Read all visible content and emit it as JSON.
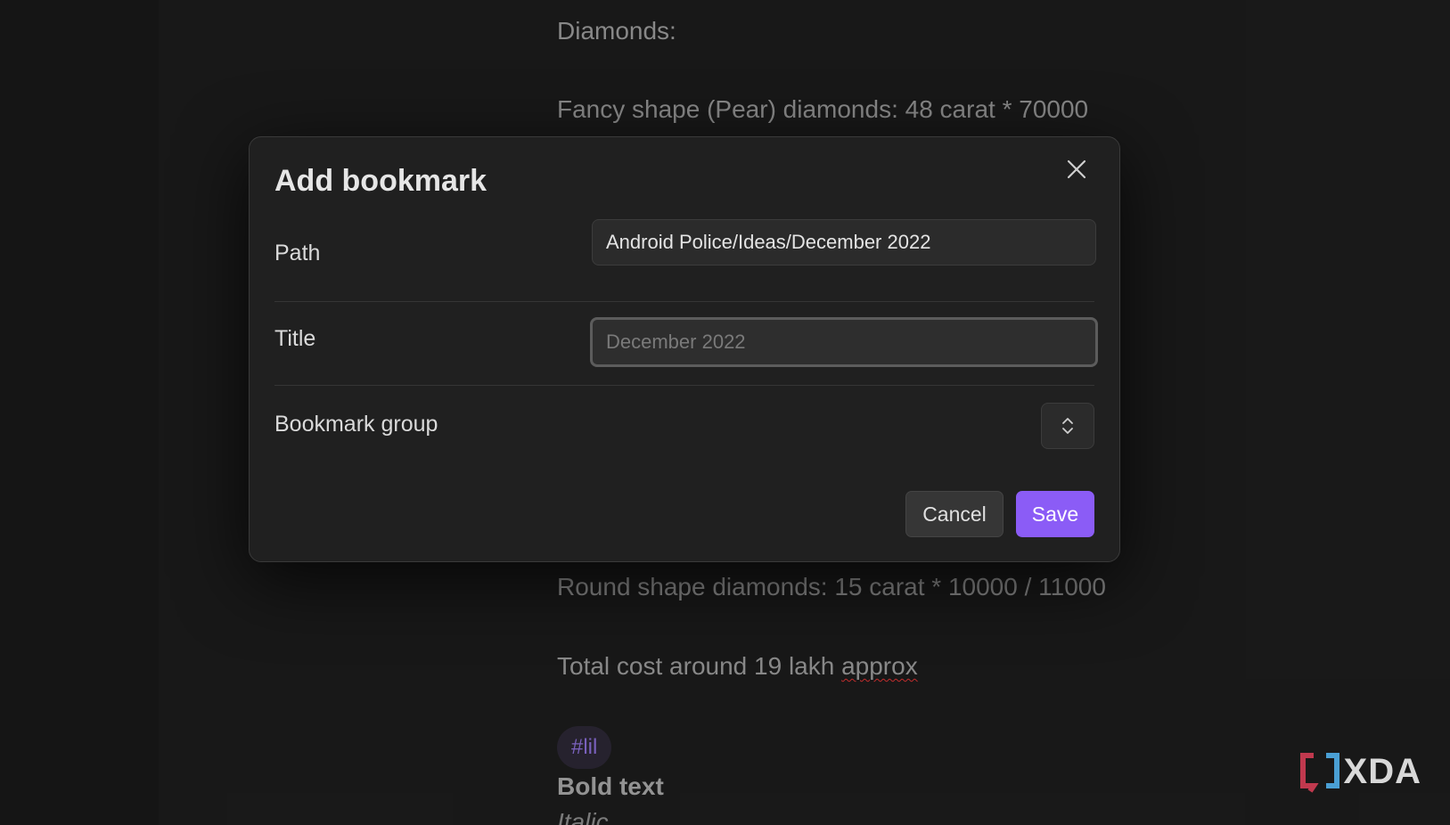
{
  "note": {
    "lines": [
      "Diamonds:",
      "Fancy shape (Pear) diamonds: 48 carat * 70000",
      "Round shape diamonds: 15 carat * 10000 / 11000"
    ],
    "total_prefix": "Total cost around 19 lakh ",
    "total_misspelled": "approx",
    "tag": "#lil",
    "bold_text": "Bold text",
    "italic_text": "Italic"
  },
  "modal": {
    "title": "Add bookmark",
    "path_label": "Path",
    "path_value": "Android Police/Ideas/December 2022",
    "title_label": "Title",
    "title_placeholder": "December 2022",
    "group_label": "Bookmark group",
    "cancel_label": "Cancel",
    "save_label": "Save"
  },
  "watermark": {
    "text": "XDA"
  },
  "colors": {
    "accent": "#8b5cf6",
    "background": "#1c1c1c",
    "modal_background": "#202020",
    "tag_text": "#8b6fd8"
  },
  "icons": [
    "close-icon",
    "chevron-up-down-icon",
    "xda-logo-icon"
  ]
}
